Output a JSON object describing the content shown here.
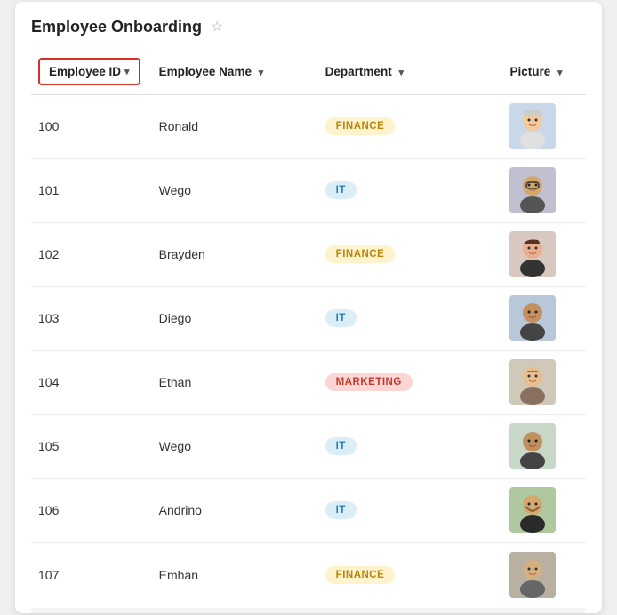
{
  "title": "Employee Onboarding",
  "columns": [
    {
      "key": "employee_id",
      "label": "Employee ID",
      "highlighted": true
    },
    {
      "key": "employee_name",
      "label": "Employee Name",
      "highlighted": false
    },
    {
      "key": "department",
      "label": "Department",
      "highlighted": false
    },
    {
      "key": "picture",
      "label": "Picture",
      "highlighted": false
    }
  ],
  "rows": [
    {
      "id": "100",
      "name": "Ronald",
      "dept": "FINANCE",
      "dept_type": "finance",
      "avatar_id": "1"
    },
    {
      "id": "101",
      "name": "Wego",
      "dept": "IT",
      "dept_type": "it",
      "avatar_id": "2"
    },
    {
      "id": "102",
      "name": "Brayden",
      "dept": "FINANCE",
      "dept_type": "finance",
      "avatar_id": "3"
    },
    {
      "id": "103",
      "name": "Diego",
      "dept": "IT",
      "dept_type": "it",
      "avatar_id": "4"
    },
    {
      "id": "104",
      "name": "Ethan",
      "dept": "MARKETING",
      "dept_type": "marketing",
      "avatar_id": "5"
    },
    {
      "id": "105",
      "name": "Wego",
      "dept": "IT",
      "dept_type": "it",
      "avatar_id": "6"
    },
    {
      "id": "106",
      "name": "Andrino",
      "dept": "IT",
      "dept_type": "it",
      "avatar_id": "7"
    },
    {
      "id": "107",
      "name": "Emhan",
      "dept": "FINANCE",
      "dept_type": "finance",
      "avatar_id": "8"
    }
  ],
  "star_label": "☆"
}
